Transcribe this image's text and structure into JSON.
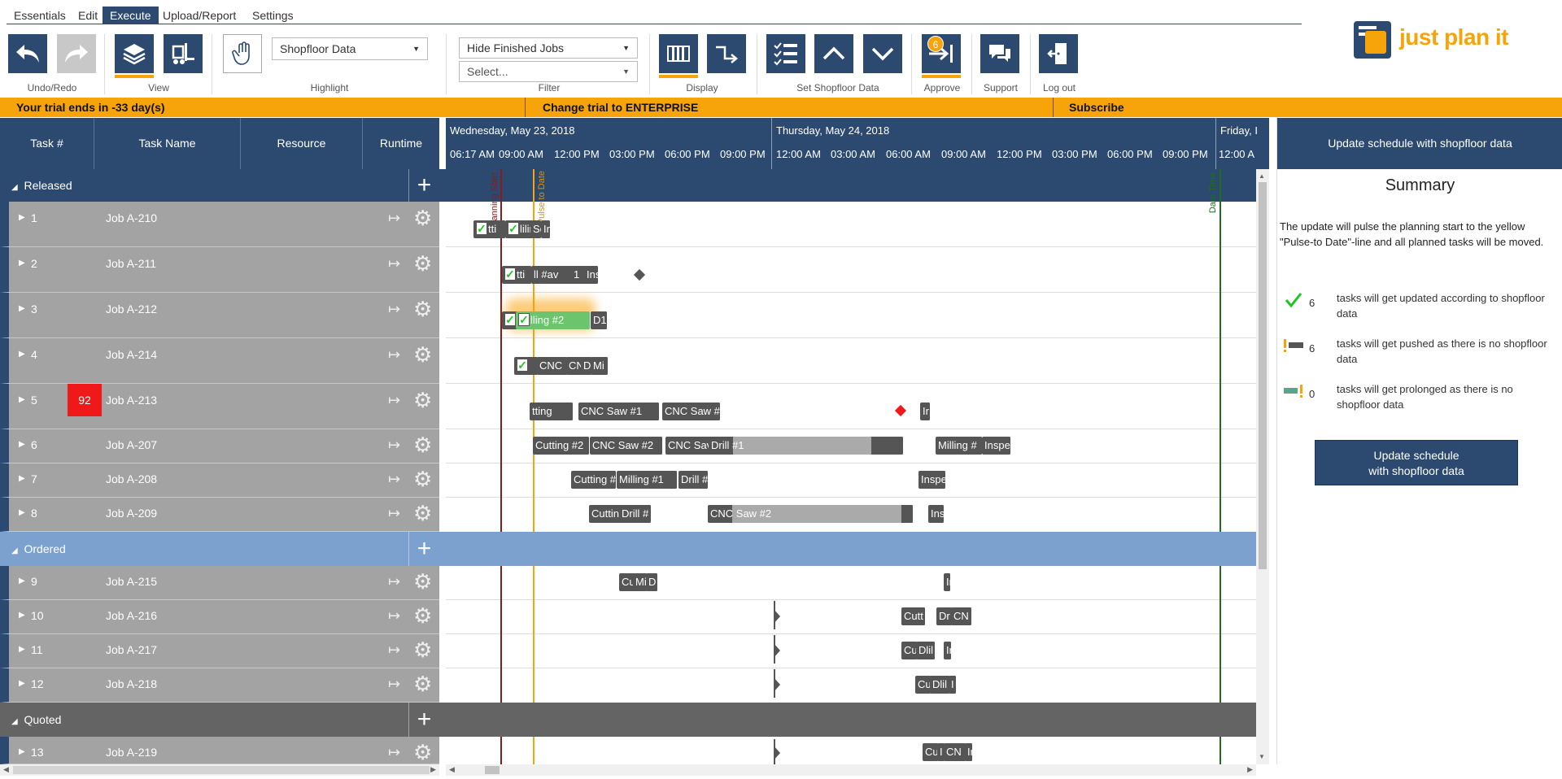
{
  "menu": [
    "Essentials",
    "Edit",
    "Execute",
    "Upload/Report",
    "Settings"
  ],
  "menu_active": "Execute",
  "logo": {
    "text": "just plan it"
  },
  "ribbon": {
    "groups": [
      "Undo/Redo",
      "View",
      "Highlight",
      "Filter",
      "Display",
      "Set Shopfloor Data",
      "Approve",
      "Support",
      "Log out"
    ],
    "highlight_select": "Shopfloor Data",
    "filter_select_1": "Hide Finished Jobs",
    "filter_select_2": "Select...",
    "approve_badge": "6"
  },
  "trial": {
    "left": "Your trial ends in -33 day(s)",
    "middle": "Change trial to ENTERPRISE",
    "right": "Subscribe"
  },
  "grid": {
    "headers": [
      "Task #",
      "Task Name",
      "Resource",
      "Runtime"
    ],
    "groups": [
      {
        "name": "Released"
      },
      {
        "name": "Ordered"
      },
      {
        "name": "Quoted"
      }
    ],
    "rows": [
      {
        "num": "1",
        "name": "Job A-210"
      },
      {
        "num": "2",
        "name": "Job A-211"
      },
      {
        "num": "3",
        "name": "Job A-212"
      },
      {
        "num": "4",
        "name": "Job A-214"
      },
      {
        "num": "5",
        "name": "Job A-213",
        "priority": "92"
      },
      {
        "num": "6",
        "name": "Job A-207"
      },
      {
        "num": "7",
        "name": "Job A-208"
      },
      {
        "num": "8",
        "name": "Job A-209"
      },
      {
        "num": "9",
        "name": "Job A-215"
      },
      {
        "num": "10",
        "name": "Job A-216"
      },
      {
        "num": "11",
        "name": "Job A-217"
      },
      {
        "num": "12",
        "name": "Job A-218"
      },
      {
        "num": "13",
        "name": "Job A-219"
      }
    ]
  },
  "timeline": {
    "days": [
      "Wednesday, May 23, 2018",
      "Thursday, May 24, 2018",
      "Friday, I"
    ],
    "hours": [
      "06:17 AM",
      "09:00 AM",
      "12:00 PM",
      "03:00 PM",
      "06:00 PM",
      "09:00 PM",
      "12:00 AM",
      "03:00 AM",
      "06:00 AM",
      "09:00 AM",
      "12:00 PM",
      "03:00 PM",
      "06:00 PM",
      "09:00 PM",
      "12:00 A"
    ],
    "lines": {
      "planning": "Planning Start",
      "pulse": "Pulse to Date",
      "date": "Date Time"
    }
  },
  "bars": {
    "r1": [
      "tti",
      "lilir",
      "Se",
      "In"
    ],
    "r2": [
      "tti",
      "ll #av",
      "1",
      "Ins"
    ],
    "r3": [
      "lling #2",
      "D1"
    ],
    "r4": [
      "CNC",
      "CN",
      "D",
      "Mi"
    ],
    "r5": [
      "tting",
      "CNC Saw #1",
      "CNC Saw #",
      "Ir"
    ],
    "r6": [
      "Cutting #2",
      "CNC Saw #2",
      "CNC Sav",
      "Drill #1",
      "Milling #",
      "Inspe"
    ],
    "r7": [
      "Cutting #",
      "Milling #1",
      "Drill #",
      "Inspe"
    ],
    "r8": [
      "Cuttin",
      "Drill #",
      "CNC Saw #2",
      "Ins"
    ],
    "r9": [
      "Cu",
      "Mi",
      "D",
      "Ir"
    ],
    "r10": [
      "Cutt",
      "Dr",
      "CN"
    ],
    "r11": [
      "Cu",
      "Dlil",
      "Ir"
    ],
    "r12": [
      "Cu",
      "Dlil",
      "I"
    ],
    "r13": [
      "Cu",
      "I",
      "CN",
      "Ir"
    ]
  },
  "summary": {
    "header": "Update schedule with shopfloor data",
    "title": "Summary",
    "desc": "The update will pulse the planning start to the yellow \"Pulse-to Date\"-line and all planned tasks will be moved.",
    "items": [
      {
        "count": "6",
        "text": "tasks will get updated according to shopfloor data"
      },
      {
        "count": "6",
        "text": "tasks will get pushed as there is no shopfloor data"
      },
      {
        "count": "0",
        "text": "tasks will get prolonged as there is no shopfloor data"
      }
    ],
    "button_line1": "Update schedule",
    "button_line2": "with shopfloor data"
  },
  "colors": {
    "navy": "#2c4a6f",
    "orange": "#f7a30a",
    "ordered": "#7da1cf",
    "quoted": "#646464",
    "row": "#a3a3a3",
    "bar": "#555555",
    "check": "#1ec71e"
  }
}
